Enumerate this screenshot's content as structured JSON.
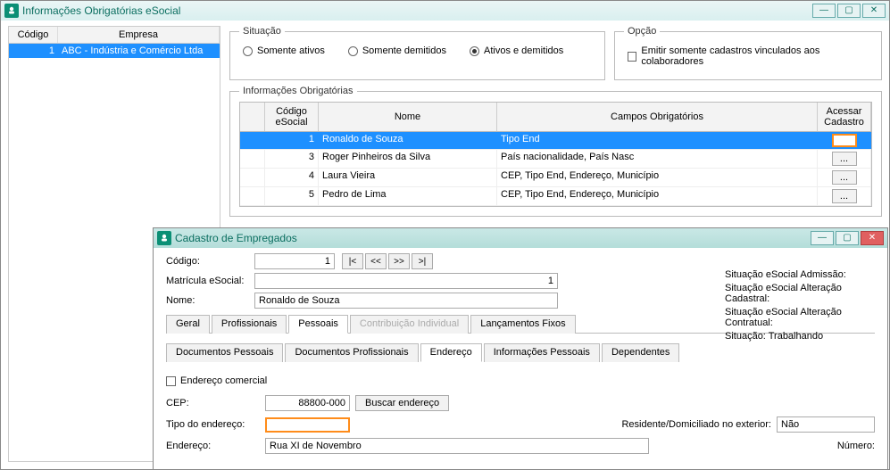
{
  "win1": {
    "title": "Informações Obrigatórias eSocial",
    "empresa": {
      "col_code": "Código",
      "col_name": "Empresa",
      "rows": [
        {
          "code": "1",
          "name": "ABC - Indústria e Comércio Ltda"
        }
      ]
    },
    "situacao": {
      "legend": "Situação",
      "opts": [
        {
          "label": "Somente ativos",
          "selected": false
        },
        {
          "label": "Somente demitidos",
          "selected": false
        },
        {
          "label": "Ativos e demitidos",
          "selected": true
        }
      ]
    },
    "opcao": {
      "legend": "Opção",
      "checkbox_label": "Emitir somente cadastros vinculados aos colaboradores"
    },
    "info_obrig": {
      "legend": "Informações Obrigatórias",
      "cols": {
        "code": "Código eSocial",
        "nome": "Nome",
        "campos": "Campos Obrigatórios",
        "acessar": "Acessar Cadastro"
      },
      "rows": [
        {
          "code": "1",
          "nome": "Ronaldo de Souza",
          "campos": "Tipo End",
          "selected": true,
          "orange": true
        },
        {
          "code": "3",
          "nome": "Roger Pinheiros da Silva",
          "campos": "País nacionalidade, País Nasc",
          "selected": false
        },
        {
          "code": "4",
          "nome": "Laura Vieira",
          "campos": "CEP, Tipo End, Endereço, Município",
          "selected": false
        },
        {
          "code": "5",
          "nome": "Pedro de Lima",
          "campos": "CEP, Tipo End, Endereço, Município",
          "selected": false
        }
      ]
    }
  },
  "win2": {
    "title": "Cadastro de Empregados",
    "fields": {
      "codigo_label": "Código:",
      "codigo_value": "1",
      "matricula_label": "Matrícula eSocial:",
      "matricula_value": "1",
      "nome_label": "Nome:",
      "nome_value": "Ronaldo de Souza"
    },
    "nav": {
      "first": "|<",
      "prev": "<<",
      "next": ">>",
      "last": ">|"
    },
    "status": {
      "admissao": "Situação eSocial Admissão:",
      "cadastral": "Situação eSocial Alteração Cadastral:",
      "contratual": "Situação eSocial Alteração Contratual:",
      "situacao": "Situação:  Trabalhando"
    },
    "tabs": [
      {
        "label": "Geral",
        "active": false
      },
      {
        "label": "Profissionais",
        "active": false
      },
      {
        "label": "Pessoais",
        "active": true
      },
      {
        "label": "Contribuição Individual",
        "active": false,
        "disabled": true
      },
      {
        "label": "Lançamentos Fixos",
        "active": false
      }
    ],
    "subtabs": [
      {
        "label": "Documentos Pessoais",
        "active": false
      },
      {
        "label": "Documentos Profissionais",
        "active": false
      },
      {
        "label": "Endereço",
        "active": true
      },
      {
        "label": "Informações Pessoais",
        "active": false
      },
      {
        "label": "Dependentes",
        "active": false
      }
    ],
    "endereco": {
      "comercial_label": "Endereço comercial",
      "cep_label": "CEP:",
      "cep_value": "88800-000",
      "buscar_btn": "Buscar endereço",
      "tipo_label": "Tipo do endereço:",
      "tipo_value": "",
      "residente_label": "Residente/Domiciliado no exterior:",
      "residente_value": "Não",
      "endereco_label": "Endereço:",
      "endereco_value": "Rua XI de Novembro",
      "numero_label": "Número:"
    }
  }
}
